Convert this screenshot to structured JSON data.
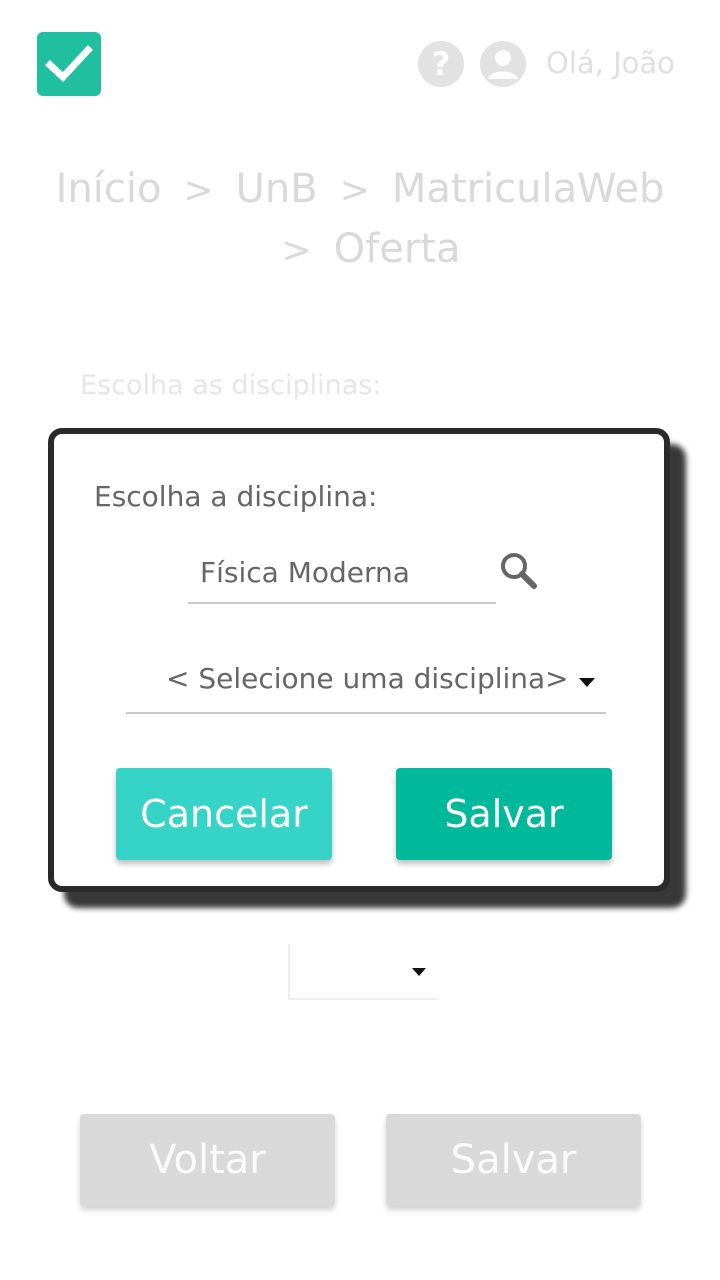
{
  "header": {
    "greeting": "Olá, João",
    "logo_icon": "check-icon",
    "help_icon": "question-icon",
    "user_icon": "user-avatar-icon",
    "brand_color": "#1fbf9f"
  },
  "breadcrumb": {
    "items": [
      "Início",
      "UnB",
      "MatriculaWeb",
      "Oferta"
    ],
    "separator": ">"
  },
  "background_form": {
    "label": "Escolha as disciplinas:",
    "back_button": "Voltar",
    "save_button": "Salvar"
  },
  "modal": {
    "title": "Escolha a disciplina:",
    "search_value": "Física Moderna",
    "select_value": "< Selecione uma disciplina>",
    "cancel_button": "Cancelar",
    "save_button": "Salvar",
    "cancel_color": "#36d4c6",
    "save_color": "#00b89a"
  }
}
